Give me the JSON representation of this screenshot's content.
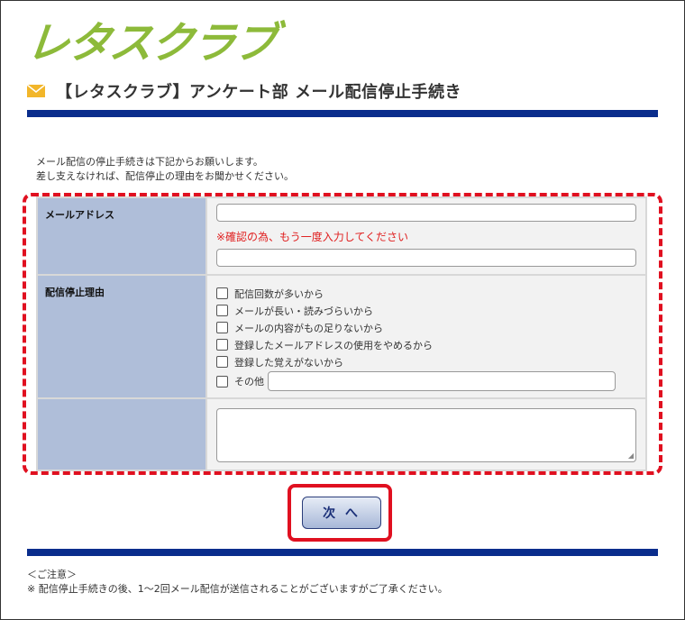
{
  "logo": {
    "text": "レタスクラブ"
  },
  "header": {
    "title": "【レタスクラブ】アンケート部 メール配信停止手続き"
  },
  "intro": {
    "line1": "メール配信の停止手続きは下記からお願いします。",
    "line2": "差し支えなければ、配信停止の理由をお聞かせください。"
  },
  "form": {
    "email_label": "メールアドレス",
    "email_value": "",
    "confirm_note": "※確認の為、もう一度入力してください",
    "email_confirm_value": "",
    "reason_label": "配信停止理由",
    "reasons": [
      {
        "label": "配信回数が多いから",
        "checked": false
      },
      {
        "label": "メールが長い・読みづらいから",
        "checked": false
      },
      {
        "label": "メールの内容がもの足りないから",
        "checked": false
      },
      {
        "label": "登録したメールアドレスの使用をやめるから",
        "checked": false
      },
      {
        "label": "登録した覚えがないから",
        "checked": false
      },
      {
        "label": "その他",
        "checked": false
      }
    ],
    "other_value": "",
    "comment_value": ""
  },
  "next_button": {
    "label": "次 へ"
  },
  "caution": {
    "heading": "＜ご注意＞",
    "text": "※ 配信停止手続きの後、1～2回メール配信が送信されることがございますがご了承ください。"
  },
  "colors": {
    "accent_bar": "#0a2d8c",
    "label_bg": "#afbed9",
    "highlight": "#e01020",
    "logo": "#8dba3a"
  }
}
